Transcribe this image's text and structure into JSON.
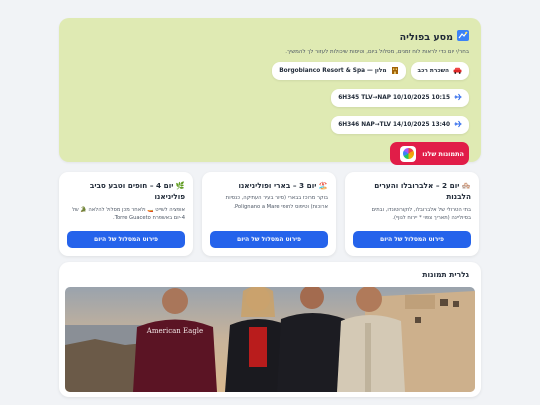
{
  "hero": {
    "icon": "map-icon",
    "title": "מסע בפוליה",
    "subtitle": "בחר/י יום כדי לראות לוח זמנים, מסלול ביום, וטיסות שיכולות לעזור לך להמשיך.",
    "chips": [
      {
        "label": "השכרת רכב",
        "icon": "car-icon"
      },
      {
        "label": "מלון — Borgobianco Resort & Spa",
        "icon": "hotel-icon"
      }
    ],
    "flights": [
      {
        "label": "6H345   TLV→NAP   10/10/2025 10:15",
        "icon": "plane-icon"
      },
      {
        "label": "6H346   NAP→TLV   14/10/2025 13:40",
        "icon": "plane-icon"
      }
    ],
    "photos_button": "התמונות שלנו"
  },
  "days": [
    {
      "title": "🏘️ יום 2 – אלברובלו והערים הלבנות",
      "desc": "בתי הטרולי של אלברובלו, לוקורוטונדו, ובתים בסיוליינה (תאריך צפוי * יירוח לנוף).",
      "button": "פירוט המסלול של היום"
    },
    {
      "title": "🏖️ יום 3 – בארי ופוליניאנו",
      "desc": "בוקר מרוכז בבארי (סיור בעיר העתיקה, כנסיות ארוכות) וטיפוס לחופי Polignano a Mare.",
      "button": "פירוט המסלול של היום"
    },
    {
      "title": "🌿 יום 4 – חופים וטבע סביב פוליניאנו",
      "desc": "אופציה לשייט 🚤 ולאחר מכן מסלול להלאה 🐊 של 4-יום באשפרח Torre Guaceto.",
      "button": "פירוט המסלול של היום"
    }
  ],
  "gallery": {
    "title": "גלרית תמונות",
    "shirt_text": "American Eagle"
  },
  "colors": {
    "hero_bg": "#dfeab3",
    "primary": "#2563eb",
    "photos_btn": "#e11d48"
  }
}
